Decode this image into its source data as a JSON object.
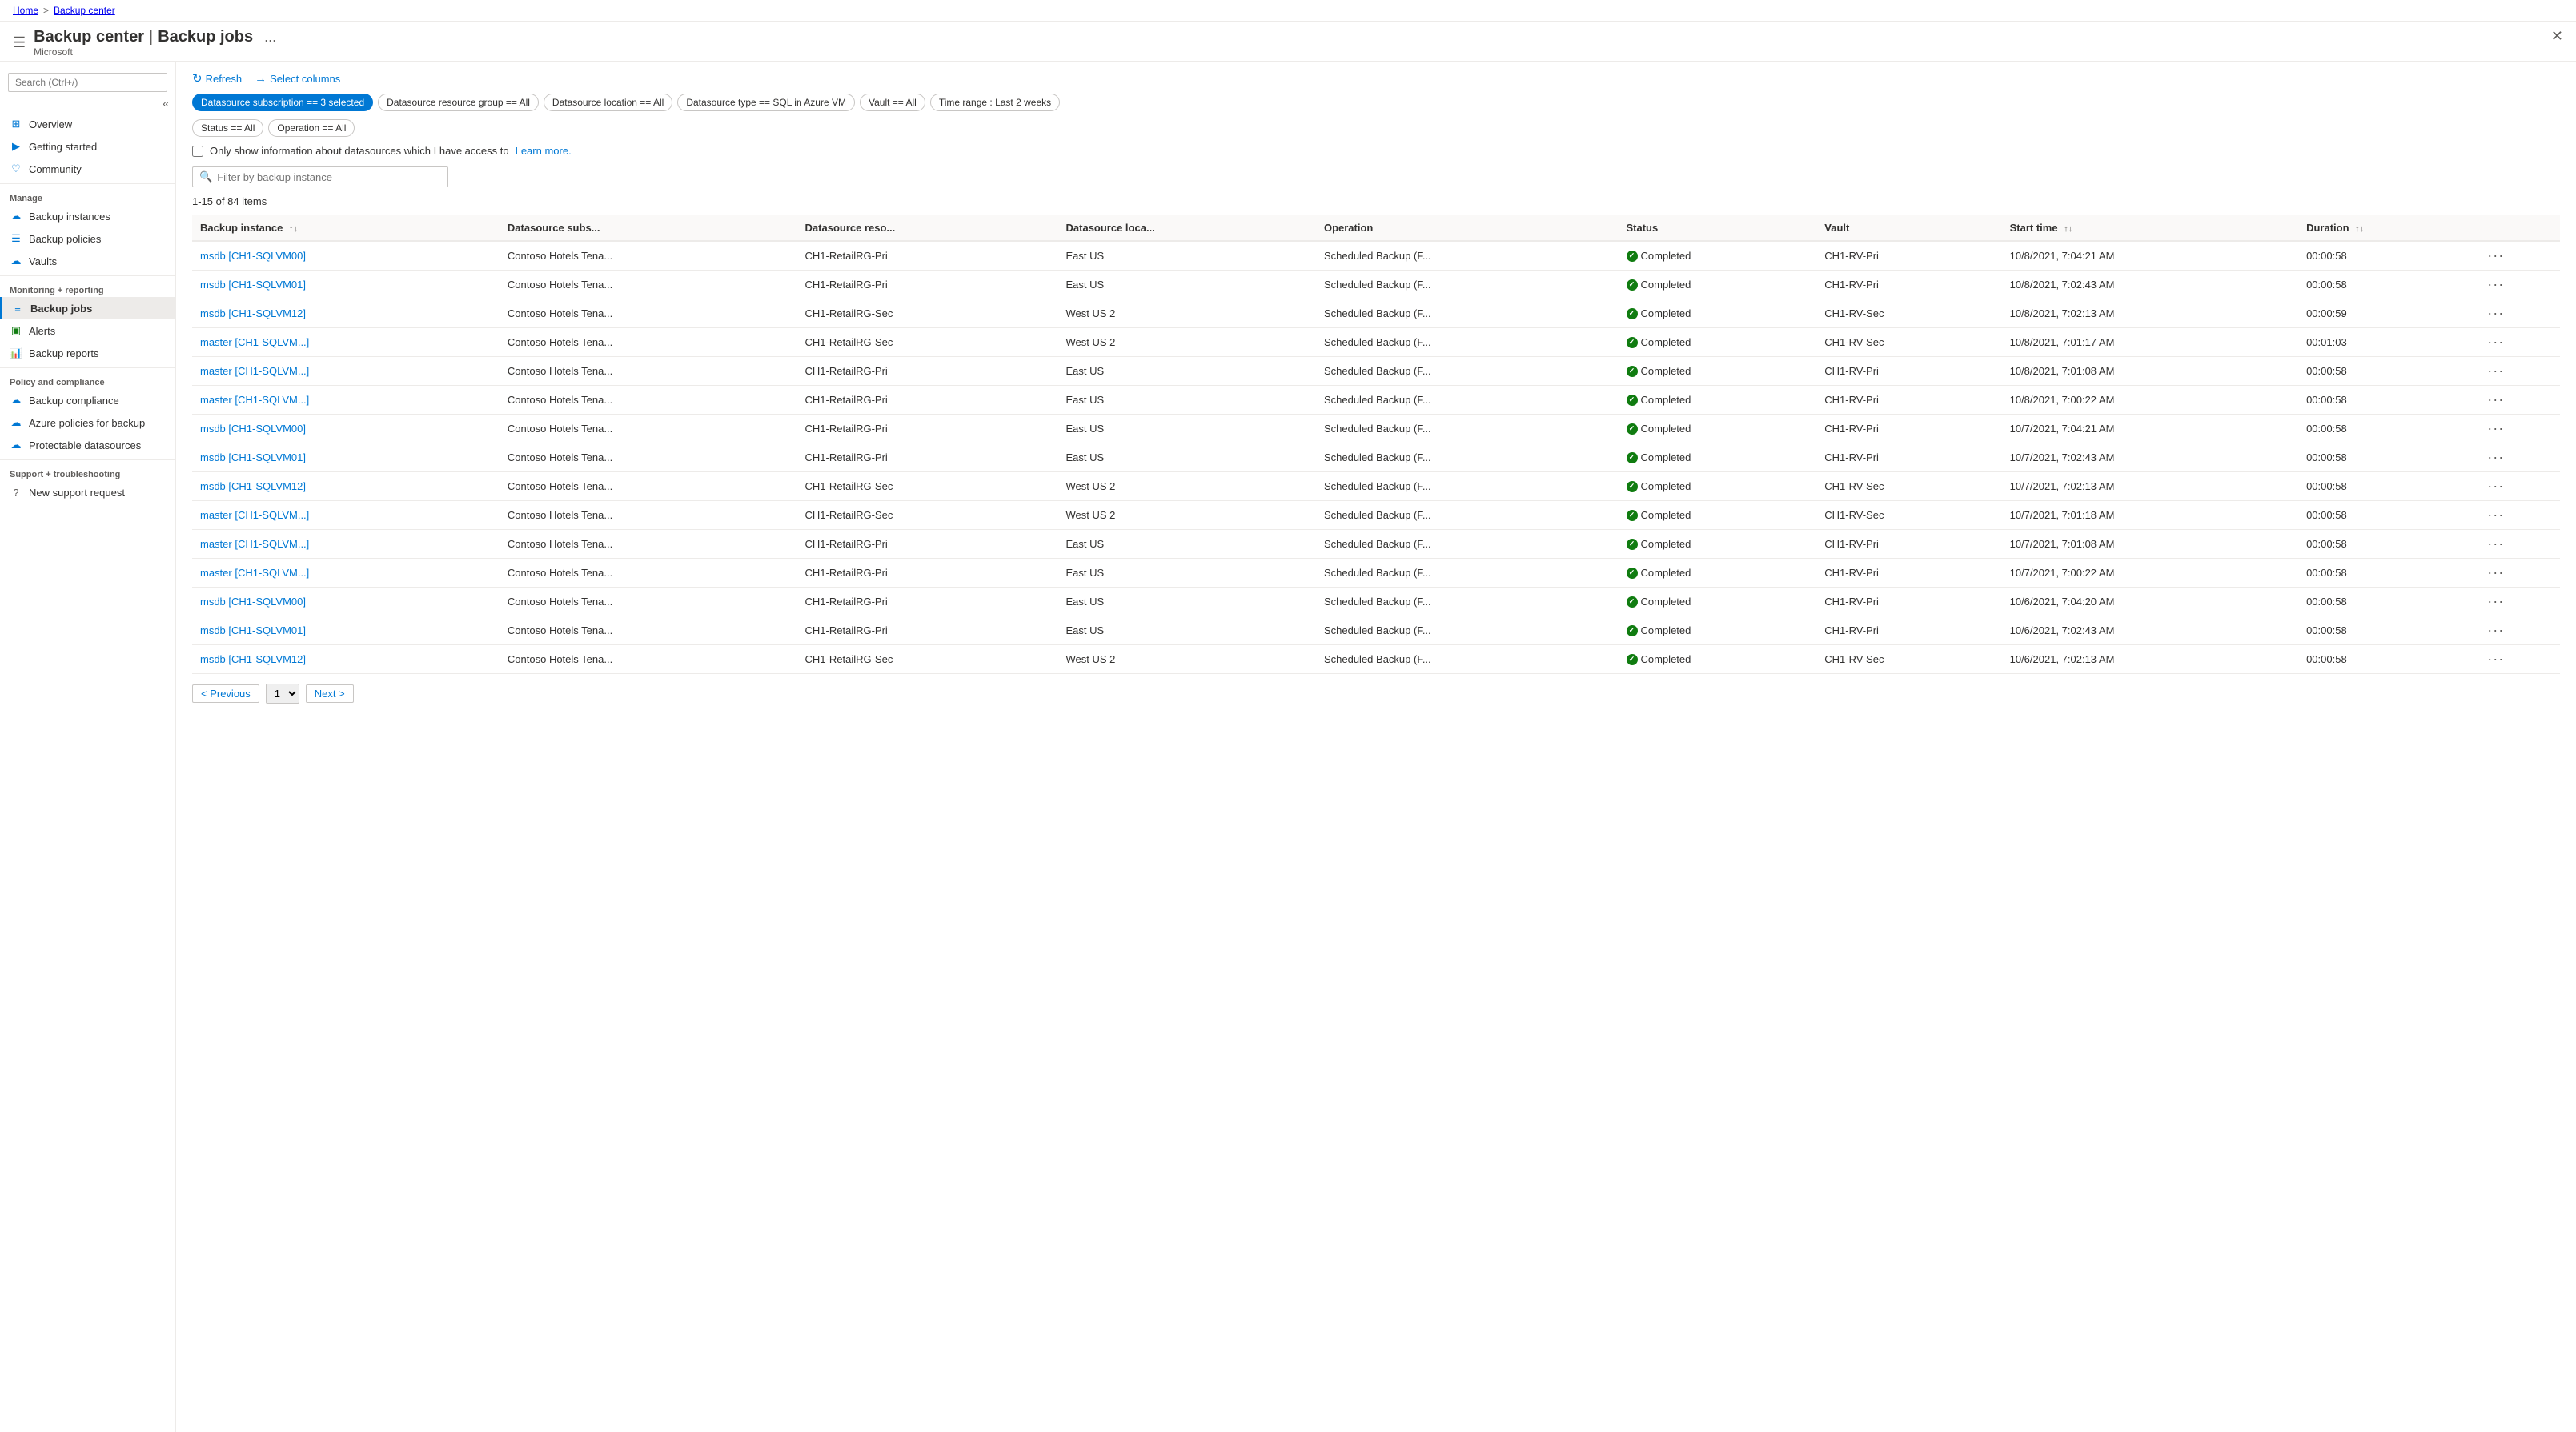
{
  "breadcrumb": {
    "home": "Home",
    "separator": ">",
    "current": "Backup center"
  },
  "header": {
    "prefix": "Backup center",
    "pipe": "|",
    "title": "Backup jobs",
    "subtitle": "Microsoft",
    "dots_label": "...",
    "close_label": "✕"
  },
  "sidebar": {
    "search_placeholder": "Search (Ctrl+/)",
    "collapse_icon": "«",
    "items": [
      {
        "id": "overview",
        "label": "Overview",
        "icon": "⊞",
        "section": ""
      },
      {
        "id": "getting-started",
        "label": "Getting started",
        "icon": "▶",
        "section": ""
      },
      {
        "id": "community",
        "label": "Community",
        "icon": "♡",
        "section": ""
      },
      {
        "id": "manage-label",
        "label": "Manage",
        "type": "section"
      },
      {
        "id": "backup-instances",
        "label": "Backup instances",
        "icon": "☁",
        "section": "Manage"
      },
      {
        "id": "backup-policies",
        "label": "Backup policies",
        "icon": "☰",
        "section": "Manage"
      },
      {
        "id": "vaults",
        "label": "Vaults",
        "icon": "☁",
        "section": "Manage"
      },
      {
        "id": "monitoring-label",
        "label": "Monitoring + reporting",
        "type": "section"
      },
      {
        "id": "backup-jobs",
        "label": "Backup jobs",
        "icon": "≡",
        "section": "Monitoring",
        "active": true
      },
      {
        "id": "alerts",
        "label": "Alerts",
        "icon": "▣",
        "section": "Monitoring"
      },
      {
        "id": "backup-reports",
        "label": "Backup reports",
        "icon": "📊",
        "section": "Monitoring"
      },
      {
        "id": "policy-label",
        "label": "Policy and compliance",
        "type": "section"
      },
      {
        "id": "backup-compliance",
        "label": "Backup compliance",
        "icon": "☁",
        "section": "Policy"
      },
      {
        "id": "azure-policies",
        "label": "Azure policies for backup",
        "icon": "☁",
        "section": "Policy"
      },
      {
        "id": "protectable",
        "label": "Protectable datasources",
        "icon": "☁",
        "section": "Policy"
      },
      {
        "id": "support-label",
        "label": "Support + troubleshooting",
        "type": "section"
      },
      {
        "id": "new-support",
        "label": "New support request",
        "icon": "?",
        "section": "Support"
      }
    ]
  },
  "toolbar": {
    "refresh_label": "Refresh",
    "select_columns_label": "Select columns"
  },
  "filters": {
    "chips": [
      {
        "id": "datasource-subscription",
        "label": "Datasource subscription == 3 selected",
        "active": true
      },
      {
        "id": "datasource-resource-group",
        "label": "Datasource resource group == All",
        "active": false
      },
      {
        "id": "datasource-location",
        "label": "Datasource location == All",
        "active": false
      },
      {
        "id": "datasource-type",
        "label": "Datasource type == SQL in Azure VM",
        "active": false
      },
      {
        "id": "vault",
        "label": "Vault == All",
        "active": false
      },
      {
        "id": "time-range",
        "label": "Time range : Last 2 weeks",
        "active": false
      },
      {
        "id": "status",
        "label": "Status == All",
        "active": false
      },
      {
        "id": "operation",
        "label": "Operation == All",
        "active": false
      }
    ],
    "checkbox_label": "Only show information about datasources which I have access to",
    "learn_more": "Learn more.",
    "filter_placeholder": "Filter by backup instance"
  },
  "table": {
    "items_count": "1-15 of 84 items",
    "columns": [
      {
        "id": "backup-instance",
        "label": "Backup instance",
        "sortable": true
      },
      {
        "id": "datasource-subs",
        "label": "Datasource subs...",
        "sortable": false
      },
      {
        "id": "datasource-reso",
        "label": "Datasource reso...",
        "sortable": false
      },
      {
        "id": "datasource-loca",
        "label": "Datasource loca...",
        "sortable": false
      },
      {
        "id": "operation",
        "label": "Operation",
        "sortable": false
      },
      {
        "id": "status",
        "label": "Status",
        "sortable": false
      },
      {
        "id": "vault",
        "label": "Vault",
        "sortable": false
      },
      {
        "id": "start-time",
        "label": "Start time",
        "sortable": true
      },
      {
        "id": "duration",
        "label": "Duration",
        "sortable": true
      },
      {
        "id": "actions",
        "label": "",
        "sortable": false
      }
    ],
    "rows": [
      {
        "backup_instance": "msdb [CH1-SQLVM00]",
        "datasource_subs": "Contoso Hotels Tena...",
        "datasource_reso": "CH1-RetailRG-Pri",
        "datasource_loca": "East US",
        "operation": "Scheduled Backup (F...",
        "status": "Completed",
        "vault": "CH1-RV-Pri",
        "start_time": "10/8/2021, 7:04:21 AM",
        "duration": "00:00:58"
      },
      {
        "backup_instance": "msdb [CH1-SQLVM01]",
        "datasource_subs": "Contoso Hotels Tena...",
        "datasource_reso": "CH1-RetailRG-Pri",
        "datasource_loca": "East US",
        "operation": "Scheduled Backup (F...",
        "status": "Completed",
        "vault": "CH1-RV-Pri",
        "start_time": "10/8/2021, 7:02:43 AM",
        "duration": "00:00:58"
      },
      {
        "backup_instance": "msdb [CH1-SQLVM12]",
        "datasource_subs": "Contoso Hotels Tena...",
        "datasource_reso": "CH1-RetailRG-Sec",
        "datasource_loca": "West US 2",
        "operation": "Scheduled Backup (F...",
        "status": "Completed",
        "vault": "CH1-RV-Sec",
        "start_time": "10/8/2021, 7:02:13 AM",
        "duration": "00:00:59"
      },
      {
        "backup_instance": "master [CH1-SQLVM...]",
        "datasource_subs": "Contoso Hotels Tena...",
        "datasource_reso": "CH1-RetailRG-Sec",
        "datasource_loca": "West US 2",
        "operation": "Scheduled Backup (F...",
        "status": "Completed",
        "vault": "CH1-RV-Sec",
        "start_time": "10/8/2021, 7:01:17 AM",
        "duration": "00:01:03"
      },
      {
        "backup_instance": "master [CH1-SQLVM...]",
        "datasource_subs": "Contoso Hotels Tena...",
        "datasource_reso": "CH1-RetailRG-Pri",
        "datasource_loca": "East US",
        "operation": "Scheduled Backup (F...",
        "status": "Completed",
        "vault": "CH1-RV-Pri",
        "start_time": "10/8/2021, 7:01:08 AM",
        "duration": "00:00:58"
      },
      {
        "backup_instance": "master [CH1-SQLVM...]",
        "datasource_subs": "Contoso Hotels Tena...",
        "datasource_reso": "CH1-RetailRG-Pri",
        "datasource_loca": "East US",
        "operation": "Scheduled Backup (F...",
        "status": "Completed",
        "vault": "CH1-RV-Pri",
        "start_time": "10/8/2021, 7:00:22 AM",
        "duration": "00:00:58"
      },
      {
        "backup_instance": "msdb [CH1-SQLVM00]",
        "datasource_subs": "Contoso Hotels Tena...",
        "datasource_reso": "CH1-RetailRG-Pri",
        "datasource_loca": "East US",
        "operation": "Scheduled Backup (F...",
        "status": "Completed",
        "vault": "CH1-RV-Pri",
        "start_time": "10/7/2021, 7:04:21 AM",
        "duration": "00:00:58"
      },
      {
        "backup_instance": "msdb [CH1-SQLVM01]",
        "datasource_subs": "Contoso Hotels Tena...",
        "datasource_reso": "CH1-RetailRG-Pri",
        "datasource_loca": "East US",
        "operation": "Scheduled Backup (F...",
        "status": "Completed",
        "vault": "CH1-RV-Pri",
        "start_time": "10/7/2021, 7:02:43 AM",
        "duration": "00:00:58"
      },
      {
        "backup_instance": "msdb [CH1-SQLVM12]",
        "datasource_subs": "Contoso Hotels Tena...",
        "datasource_reso": "CH1-RetailRG-Sec",
        "datasource_loca": "West US 2",
        "operation": "Scheduled Backup (F...",
        "status": "Completed",
        "vault": "CH1-RV-Sec",
        "start_time": "10/7/2021, 7:02:13 AM",
        "duration": "00:00:58"
      },
      {
        "backup_instance": "master [CH1-SQLVM...]",
        "datasource_subs": "Contoso Hotels Tena...",
        "datasource_reso": "CH1-RetailRG-Sec",
        "datasource_loca": "West US 2",
        "operation": "Scheduled Backup (F...",
        "status": "Completed",
        "vault": "CH1-RV-Sec",
        "start_time": "10/7/2021, 7:01:18 AM",
        "duration": "00:00:58"
      },
      {
        "backup_instance": "master [CH1-SQLVM...]",
        "datasource_subs": "Contoso Hotels Tena...",
        "datasource_reso": "CH1-RetailRG-Pri",
        "datasource_loca": "East US",
        "operation": "Scheduled Backup (F...",
        "status": "Completed",
        "vault": "CH1-RV-Pri",
        "start_time": "10/7/2021, 7:01:08 AM",
        "duration": "00:00:58"
      },
      {
        "backup_instance": "master [CH1-SQLVM...]",
        "datasource_subs": "Contoso Hotels Tena...",
        "datasource_reso": "CH1-RetailRG-Pri",
        "datasource_loca": "East US",
        "operation": "Scheduled Backup (F...",
        "status": "Completed",
        "vault": "CH1-RV-Pri",
        "start_time": "10/7/2021, 7:00:22 AM",
        "duration": "00:00:58"
      },
      {
        "backup_instance": "msdb [CH1-SQLVM00]",
        "datasource_subs": "Contoso Hotels Tena...",
        "datasource_reso": "CH1-RetailRG-Pri",
        "datasource_loca": "East US",
        "operation": "Scheduled Backup (F...",
        "status": "Completed",
        "vault": "CH1-RV-Pri",
        "start_time": "10/6/2021, 7:04:20 AM",
        "duration": "00:00:58"
      },
      {
        "backup_instance": "msdb [CH1-SQLVM01]",
        "datasource_subs": "Contoso Hotels Tena...",
        "datasource_reso": "CH1-RetailRG-Pri",
        "datasource_loca": "East US",
        "operation": "Scheduled Backup (F...",
        "status": "Completed",
        "vault": "CH1-RV-Pri",
        "start_time": "10/6/2021, 7:02:43 AM",
        "duration": "00:00:58"
      },
      {
        "backup_instance": "msdb [CH1-SQLVM12]",
        "datasource_subs": "Contoso Hotels Tena...",
        "datasource_reso": "CH1-RetailRG-Sec",
        "datasource_loca": "West US 2",
        "operation": "Scheduled Backup (F...",
        "status": "Completed",
        "vault": "CH1-RV-Sec",
        "start_time": "10/6/2021, 7:02:13 AM",
        "duration": "00:00:58"
      }
    ]
  },
  "pagination": {
    "previous_label": "< Previous",
    "next_label": "Next >",
    "page_number": "1"
  }
}
